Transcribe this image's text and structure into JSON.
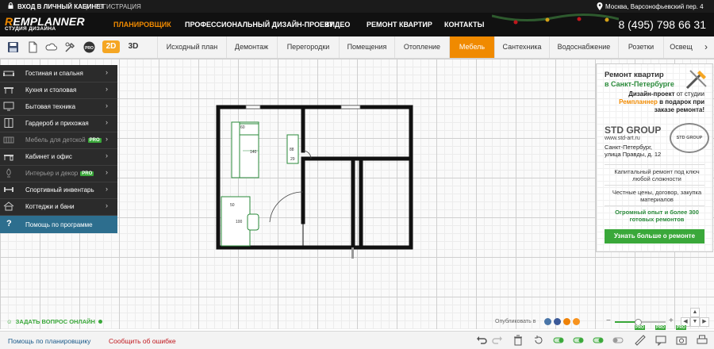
{
  "topbar": {
    "login": "ВХОД В ЛИЧНЫЙ КАБИНЕТ",
    "register": "РЕГИСТРАЦИЯ",
    "address": "Москва, Варсонофьевский пер. 4"
  },
  "logo": {
    "line1_accent": "R",
    "line1": "EMPLANNER",
    "line2": "СТУДИЯ ДИЗАЙНА"
  },
  "nav": {
    "items": [
      "ПЛАНИРОВЩИК",
      "ПРОФЕССИОНАЛЬНЫЙ ДИЗАЙН-ПРОЕКТ",
      "ВИДЕО",
      "РЕМОНТ КВАРТИР",
      "КОНТАКТЫ"
    ],
    "phone": "8 (495) 798 66 31",
    "active_color": "#f08a00"
  },
  "toolbar": {
    "icons": [
      "save-icon",
      "open-icon",
      "cloud-icon",
      "tools-icon",
      "settings-icon",
      "pro-icon"
    ],
    "view_2d": "2D",
    "view_3d": "3D",
    "tabs": [
      "Исходный план",
      "Демонтаж",
      "Перегородки",
      "Помещения",
      "Отопление",
      "Мебель",
      "Сантехника",
      "Водоснабжение",
      "Розетки",
      "Освещ"
    ],
    "active_tab": "Мебель"
  },
  "furniture_menu": [
    {
      "label": "Гостиная и спальня",
      "icon": "sofa-icon"
    },
    {
      "label": "Кухня и столовая",
      "icon": "table-icon"
    },
    {
      "label": "Бытовая техника",
      "icon": "tv-icon"
    },
    {
      "label": "Гардероб и прихожая",
      "icon": "wardrobe-icon"
    },
    {
      "label": "Мебель для детской",
      "icon": "crib-icon",
      "pro": "PRO"
    },
    {
      "label": "Кабинет и офис",
      "icon": "desk-icon"
    },
    {
      "label": "Интерьер и декор",
      "icon": "decor-icon",
      "pro": "PRO"
    },
    {
      "label": "Спортивный инвентарь",
      "icon": "dumbbell-icon"
    },
    {
      "label": "Коттеджи и бани",
      "icon": "house-icon"
    },
    {
      "label": "Помощь по программе",
      "icon": "help-icon"
    }
  ],
  "plan": {
    "labels": [
      "60",
      "140",
      "88",
      "29",
      "50",
      "100"
    ]
  },
  "ad": {
    "title": "Ремонт квартир",
    "city": "в Санкт-Петербурге",
    "promo_a": "Дизайн-проект",
    "promo_b": " от студии",
    "promo_brand": "Ремпланнер",
    "promo_c": " в подарок при заказе ремонта!",
    "company": "STD GROUP",
    "site": "www.std-art.ru",
    "address": "Санкт-Петербург, улица Правды, д. 12",
    "badge": "STD GROUP",
    "feature1": "Капитальный ремонт под ключ любой сложности",
    "feature2": "Честные цены, договор, закупка материалов",
    "feature3": "Огромный опыт и более 300 готовых ремонтов",
    "cta": "Узнать больше о ремонте"
  },
  "status": {
    "ask": "ЗАДАТЬ ВОПРОС ОНЛАЙН",
    "publish": "Опубликовать в",
    "zoom_level": 0.45,
    "zoom_minus": "−",
    "zoom_plus": "+"
  },
  "bottombar": {
    "help": "Помощь по планировщику",
    "report": "Сообщить об ошибке",
    "pro": "PRO"
  }
}
